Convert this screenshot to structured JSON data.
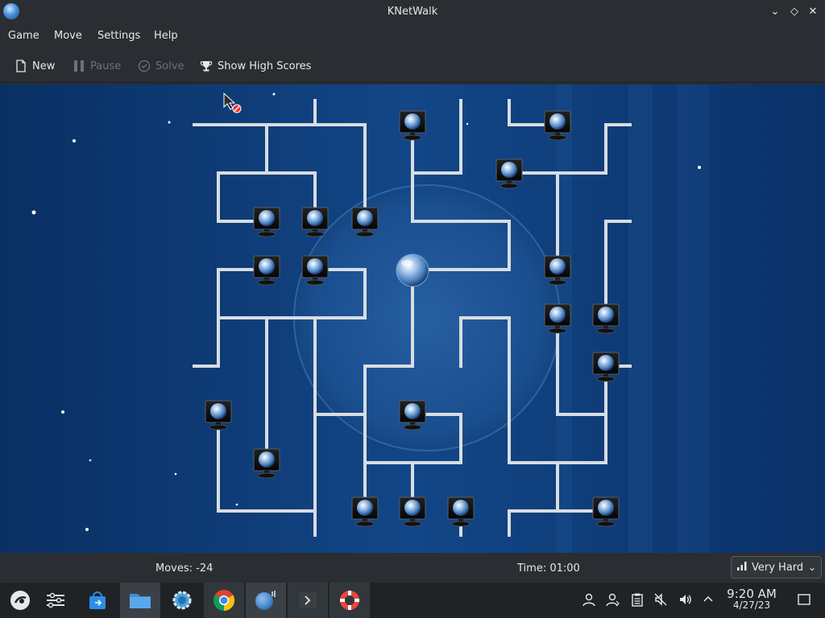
{
  "window": {
    "title": "KNetWalk"
  },
  "menu": {
    "items": [
      "Game",
      "Move",
      "Settings",
      "Help"
    ]
  },
  "toolbar": {
    "new_label": "New",
    "pause_label": "Pause",
    "solve_label": "Solve",
    "scores_label": "Show High Scores"
  },
  "status": {
    "moves": "Moves: -24",
    "time": "Time: 01:00",
    "difficulty": "Very Hard"
  },
  "clock": {
    "time": "9:20 AM",
    "date": "4/27/23"
  },
  "colors": {
    "board_bg": "#0e3a75",
    "pipe": "#d8dde2",
    "window_bg": "#2a2e32",
    "taskbar_bg": "#1f2326"
  },
  "icons": [
    "app-menu-icon",
    "settings-icon",
    "store-icon",
    "files-icon",
    "system-settings-icon",
    "chrome-icon",
    "knetwalk-icon",
    "terminal-icon",
    "help-icon"
  ]
}
